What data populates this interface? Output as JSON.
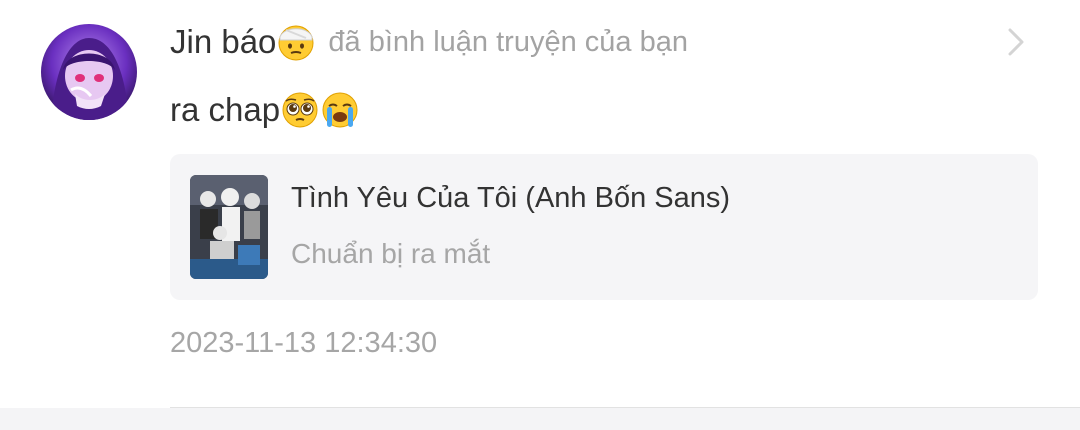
{
  "notification": {
    "user": {
      "name": "Jin báo",
      "name_emoji": "face-with-head-bandage-emoji",
      "avatar": "avatar-purple-anime-girl"
    },
    "action_text": "đã bình luận truyện của bạn",
    "comment": {
      "text": "ra chap",
      "emojis": [
        "pleading-face-emoji",
        "loudly-crying-face-emoji"
      ]
    },
    "story": {
      "title": "Tình Yêu Của Tôi (Anh Bốn Sans)",
      "status": "Chuẩn bị ra mắt",
      "cover": "story-cover-thumbnail"
    },
    "timestamp": "2023-11-13 12:34:30",
    "chevron_icon": "chevron-right-icon"
  },
  "colors": {
    "primary_text": "#333333",
    "secondary_text": "#a6a6a6",
    "card_background": "#f5f5f7",
    "avatar_accent": "#7b3fd1"
  }
}
